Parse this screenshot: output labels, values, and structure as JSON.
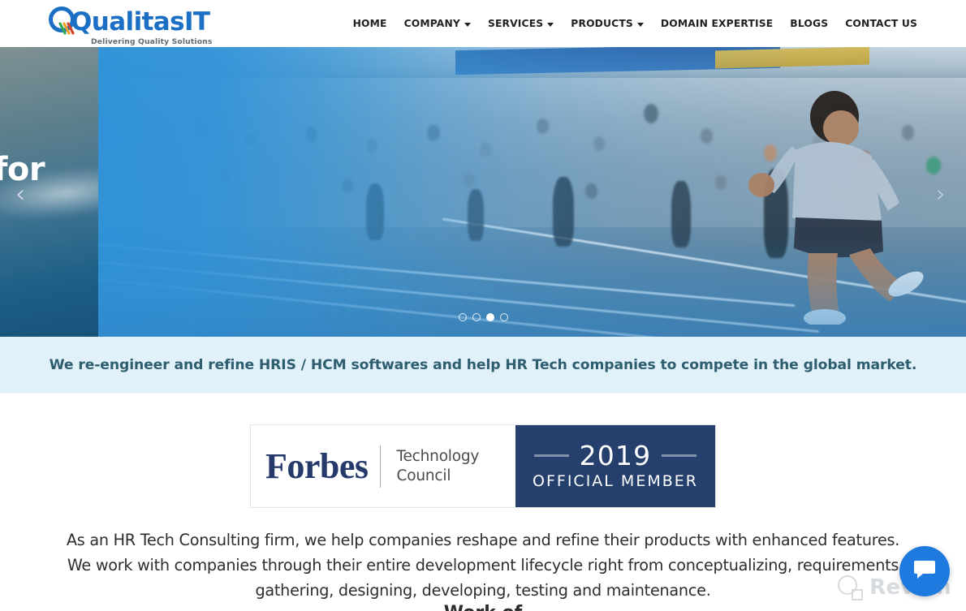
{
  "brand": {
    "logo_word_1": "Qualitas",
    "logo_word_2": "IT",
    "tagline": "Delivering Quality Solutions",
    "accent_blue": "#1b6fc4",
    "accent_green": "#34a853",
    "accent_orange": "#f0a02a",
    "accent_red": "#d3442f"
  },
  "nav": {
    "items": [
      {
        "label": "HOME",
        "has_caret": false
      },
      {
        "label": "COMPANY",
        "has_caret": true
      },
      {
        "label": "SERVICES",
        "has_caret": true
      },
      {
        "label": "PRODUCTS",
        "has_caret": true
      },
      {
        "label": "DOMAIN EXPERTISE",
        "has_caret": false
      },
      {
        "label": "BLOGS",
        "has_caret": false
      },
      {
        "label": "CONTACT US",
        "has_caret": false
      }
    ]
  },
  "hero": {
    "prev_slide_text": "for",
    "prev_arrow": "‹",
    "next_arrow": "›",
    "dots_total": 4,
    "dots_active_index": 2,
    "overlay_color": "#2d91d8"
  },
  "tagband": {
    "text": "We re-engineer and refine HRIS / HCM softwares and help HR Tech companies to compete in the global market.",
    "background": "#e1f1f9",
    "text_color": "#2e5d70"
  },
  "forbes": {
    "name": "Forbes",
    "subtitle_line_1": "Technology",
    "subtitle_line_2": "Council",
    "year": "2019",
    "member_label": "OFFICIAL MEMBER",
    "panel_color": "#26406e"
  },
  "main": {
    "intro": "As an HR Tech Consulting firm, we help companies reshape and refine their products with enhanced features. We work with companies through their entire development lifecycle right from conceptualizing, requirements gathering, designing, developing, testing and maintenance.",
    "next_section_heading": "Work of"
  },
  "widgets": {
    "watermark_text": "Revain",
    "chat_icon": "chat-bubble-icon",
    "chat_color": "#1f7ae0"
  }
}
